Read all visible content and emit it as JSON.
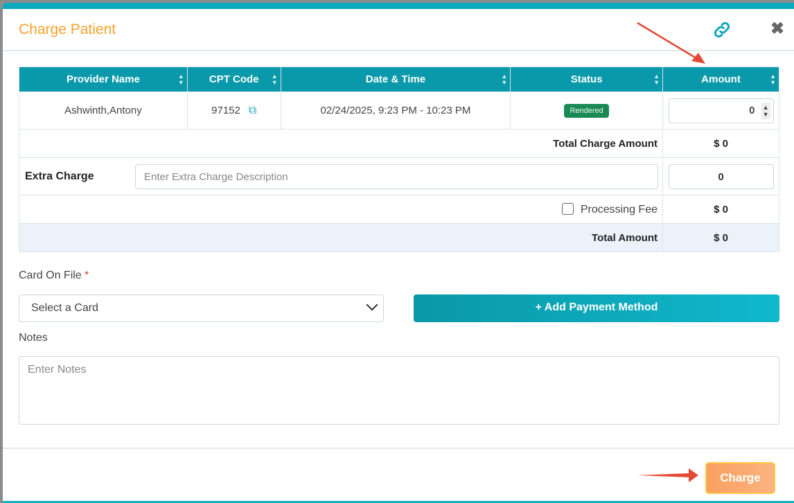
{
  "modal": {
    "title": "Charge Patient"
  },
  "table": {
    "headers": [
      "Provider Name",
      "CPT Code",
      "Date & Time",
      "Status",
      "Amount"
    ],
    "row": {
      "provider": "Ashwinth,Antony",
      "cpt": "97152",
      "datetime": "02/24/2025, 9:23 PM - 10:23 PM",
      "status": "Rendered",
      "amount": "0"
    },
    "total_charge_label": "Total Charge Amount",
    "total_charge_value": "$ 0",
    "extra_charge_label": "Extra Charge",
    "extra_charge_placeholder": "Enter Extra Charge Description",
    "extra_charge_amount": "0",
    "processing_fee_label": "Processing Fee",
    "processing_fee_value": "$ 0",
    "total_amount_label": "Total Amount",
    "total_amount_value": "$ 0"
  },
  "form": {
    "card_label": "Card On File",
    "required_mark": "*",
    "card_select": "Select a Card",
    "add_payment": "+ Add Payment Method",
    "notes_label": "Notes",
    "notes_placeholder": "Enter Notes"
  },
  "footer": {
    "charge": "Charge"
  },
  "colors": {
    "accent": "#0a99aa",
    "title": "#f8a12a",
    "badge": "#1a8a55"
  }
}
